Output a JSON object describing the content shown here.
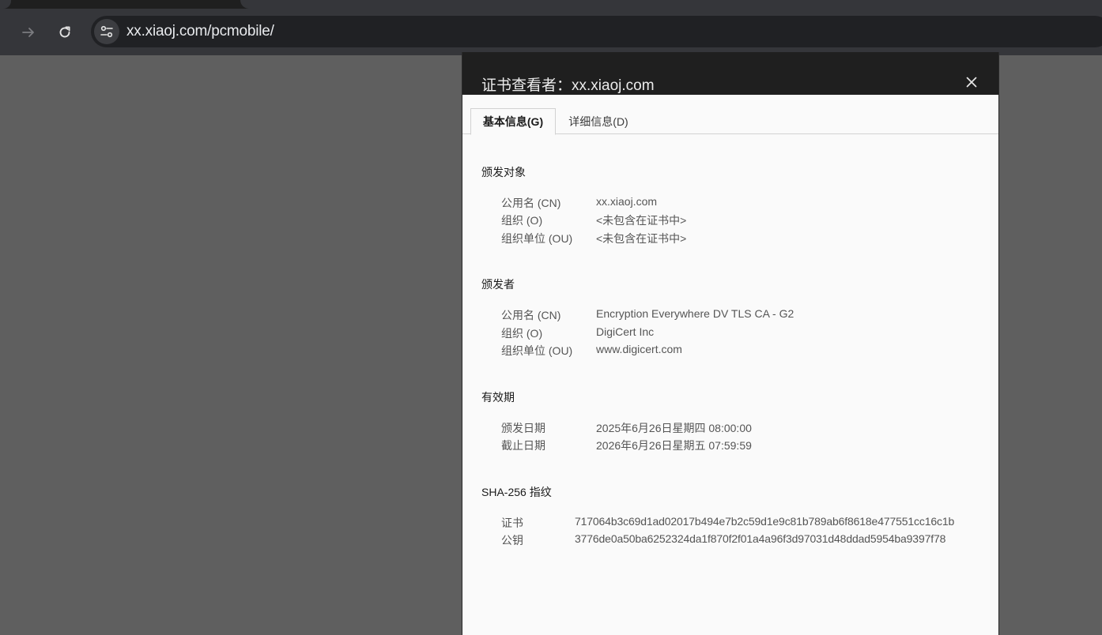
{
  "browser": {
    "url": "xx.xiaoj.com/pcmobile/",
    "icons": {
      "forward": "arrow-forward-icon",
      "reload": "reload-icon",
      "site_info": "tune-icon"
    }
  },
  "dialog": {
    "title": "证书查看者：xx.xiaoj.com",
    "close_icon": "close-icon",
    "tabs": [
      {
        "label": "基本信息(G)",
        "selected": true
      },
      {
        "label": "详细信息(D)",
        "selected": false
      }
    ],
    "issued_to": {
      "heading": "颁发对象",
      "rows": [
        {
          "label": "公用名 (CN)",
          "value": "xx.xiaoj.com"
        },
        {
          "label": "组织 (O)",
          "value": "<未包含在证书中>"
        },
        {
          "label": "组织单位 (OU)",
          "value": "<未包含在证书中>"
        }
      ]
    },
    "issued_by": {
      "heading": "颁发者",
      "rows": [
        {
          "label": "公用名 (CN)",
          "value": "Encryption Everywhere DV TLS CA - G2"
        },
        {
          "label": "组织 (O)",
          "value": "DigiCert Inc"
        },
        {
          "label": "组织单位 (OU)",
          "value": "www.digicert.com"
        }
      ]
    },
    "validity": {
      "heading": "有效期",
      "rows": [
        {
          "label": "颁发日期",
          "value": "2025年6月26日星期四 08:00:00"
        },
        {
          "label": "截止日期",
          "value": "2026年6月26日星期五 07:59:59"
        }
      ]
    },
    "fingerprints": {
      "heading": "SHA-256 指纹",
      "rows": [
        {
          "label": "证书",
          "value": "717064b3c69d1ad02017b494e7b2c59d1e9c81b789ab6f8618e477551cc16c1b"
        },
        {
          "label": "公钥",
          "value": "3776de0a50ba6252324da1f870f2f01a4a96f3d97031d48ddad5954ba9397f78"
        }
      ]
    }
  },
  "colors": {
    "chrome_bg": "#35363a",
    "omnibox_bg": "#202124",
    "dim_bg": "#5f5f5f",
    "dialog_header": "#1f1f1f",
    "dialog_body": "#fafafa"
  }
}
